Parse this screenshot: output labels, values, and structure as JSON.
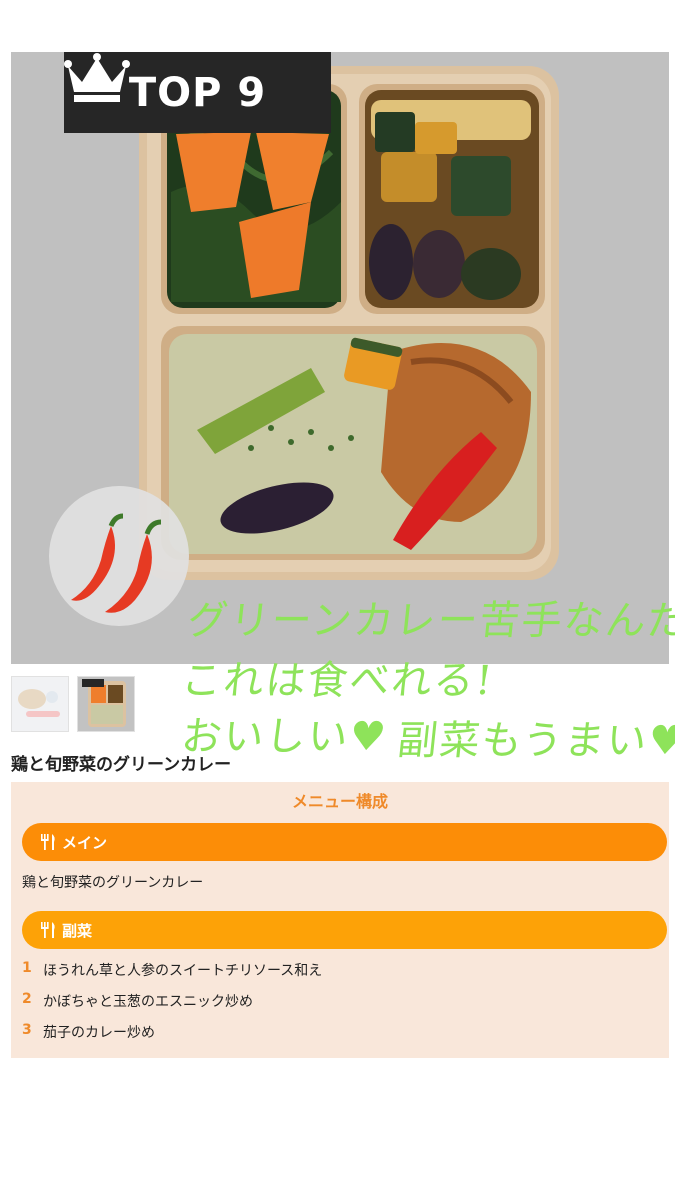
{
  "hero": {
    "rank_badge": {
      "text": "TOP 9",
      "icon": "crown-icon"
    },
    "spice_icon": "chili-pepper-icon"
  },
  "handwriting": {
    "line1": "グリーンカレー苦手なんだけど",
    "line2": "これは食べれる!",
    "line3": "おいしい♥",
    "line4": "副菜もうまい♥",
    "color": "#8ee35a"
  },
  "product": {
    "title": "鶏と旬野菜のグリーンカレー"
  },
  "menu": {
    "heading": "メニュー構成",
    "main_label": "メイン",
    "main_dish": "鶏と旬野菜のグリーンカレー",
    "side_label": "副菜",
    "sides": [
      {
        "num": "1",
        "name": "ほうれん草と人参のスイートチリソース和え"
      },
      {
        "num": "2",
        "name": "かぼちゃと玉葱のエスニック炒め"
      },
      {
        "num": "3",
        "name": "茄子のカレー炒め"
      }
    ]
  },
  "colors": {
    "accent_orange": "#fc8d07",
    "side_orange": "#fda207",
    "panel_bg": "#f9e7da",
    "heading_orange": "#ef8a2a"
  }
}
